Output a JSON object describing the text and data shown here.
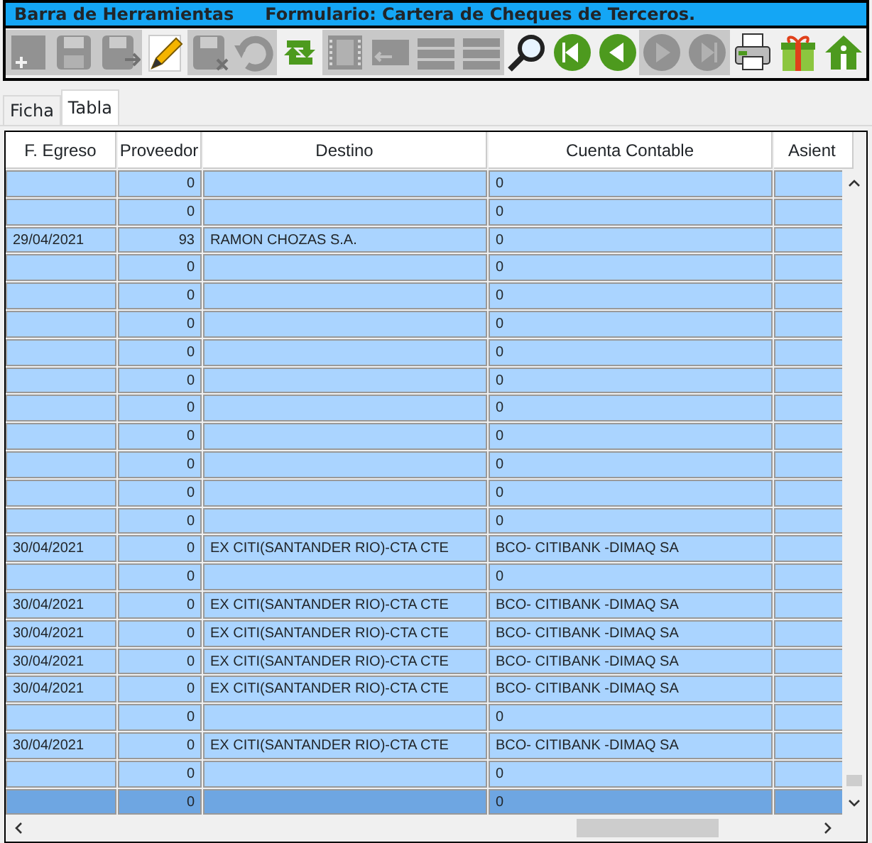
{
  "title_bar": {
    "left": "Barra de Herramientas",
    "right": "Formulario: Cartera de Cheques de Terceros."
  },
  "toolbar": [
    {
      "kind": "add",
      "disabled": true
    },
    {
      "kind": "save",
      "disabled": true
    },
    {
      "kind": "save-as",
      "disabled": true
    },
    {
      "kind": "edit",
      "disabled": false
    },
    {
      "kind": "delete",
      "disabled": true
    },
    {
      "kind": "undo",
      "disabled": true
    },
    {
      "kind": "refresh",
      "disabled": false
    },
    {
      "kind": "film",
      "disabled": true
    },
    {
      "kind": "back",
      "disabled": true
    },
    {
      "kind": "list",
      "disabled": true
    },
    {
      "kind": "list",
      "disabled": true
    },
    {
      "kind": "search",
      "disabled": false
    },
    {
      "kind": "first",
      "disabled": false
    },
    {
      "kind": "prev",
      "disabled": false
    },
    {
      "kind": "next",
      "disabled": true
    },
    {
      "kind": "last",
      "disabled": true
    },
    {
      "kind": "print",
      "disabled": false
    },
    {
      "kind": "gift",
      "disabled": false
    },
    {
      "kind": "home",
      "disabled": false
    }
  ],
  "tabs": [
    {
      "label": "Ficha",
      "selected": false
    },
    {
      "label": "Tabla",
      "selected": true
    }
  ],
  "table": {
    "columns": [
      "F. Egreso",
      "Proveedor",
      "Destino",
      "Cuenta Contable",
      "Asient"
    ],
    "rows": [
      {
        "cells": [
          "",
          "0",
          "",
          "0"
        ],
        "selected": false
      },
      {
        "cells": [
          "",
          "0",
          "",
          "0"
        ],
        "selected": false
      },
      {
        "cells": [
          "29/04/2021",
          "93",
          "RAMON CHOZAS S.A.",
          "0"
        ],
        "selected": false
      },
      {
        "cells": [
          "",
          "0",
          "",
          "0"
        ],
        "selected": false
      },
      {
        "cells": [
          "",
          "0",
          "",
          "0"
        ],
        "selected": false
      },
      {
        "cells": [
          "",
          "0",
          "",
          "0"
        ],
        "selected": false
      },
      {
        "cells": [
          "",
          "0",
          "",
          "0"
        ],
        "selected": false
      },
      {
        "cells": [
          "",
          "0",
          "",
          "0"
        ],
        "selected": false
      },
      {
        "cells": [
          "",
          "0",
          "",
          "0"
        ],
        "selected": false
      },
      {
        "cells": [
          "",
          "0",
          "",
          "0"
        ],
        "selected": false
      },
      {
        "cells": [
          "",
          "0",
          "",
          "0"
        ],
        "selected": false
      },
      {
        "cells": [
          "",
          "0",
          "",
          "0"
        ],
        "selected": false
      },
      {
        "cells": [
          "",
          "0",
          "",
          "0"
        ],
        "selected": false
      },
      {
        "cells": [
          "30/04/2021",
          "0",
          "EX CITI(SANTANDER RIO)-CTA CTE",
          "BCO- CITIBANK -DIMAQ SA"
        ],
        "selected": false
      },
      {
        "cells": [
          "",
          "0",
          "",
          "0"
        ],
        "selected": false
      },
      {
        "cells": [
          "30/04/2021",
          "0",
          "EX CITI(SANTANDER RIO)-CTA CTE",
          "BCO- CITIBANK -DIMAQ SA"
        ],
        "selected": false
      },
      {
        "cells": [
          "30/04/2021",
          "0",
          "EX CITI(SANTANDER RIO)-CTA CTE",
          "BCO- CITIBANK -DIMAQ SA"
        ],
        "selected": false
      },
      {
        "cells": [
          "30/04/2021",
          "0",
          "EX CITI(SANTANDER RIO)-CTA CTE",
          "BCO- CITIBANK -DIMAQ SA"
        ],
        "selected": false
      },
      {
        "cells": [
          "30/04/2021",
          "0",
          "EX CITI(SANTANDER RIO)-CTA CTE",
          "BCO- CITIBANK -DIMAQ SA"
        ],
        "selected": false
      },
      {
        "cells": [
          "",
          "0",
          "",
          "0"
        ],
        "selected": false
      },
      {
        "cells": [
          "30/04/2021",
          "0",
          "EX CITI(SANTANDER RIO)-CTA CTE",
          "BCO- CITIBANK -DIMAQ SA"
        ],
        "selected": false
      },
      {
        "cells": [
          "",
          "0",
          "",
          "0"
        ],
        "selected": false
      },
      {
        "cells": [
          "",
          "0",
          "",
          "0"
        ],
        "selected": true
      }
    ]
  }
}
